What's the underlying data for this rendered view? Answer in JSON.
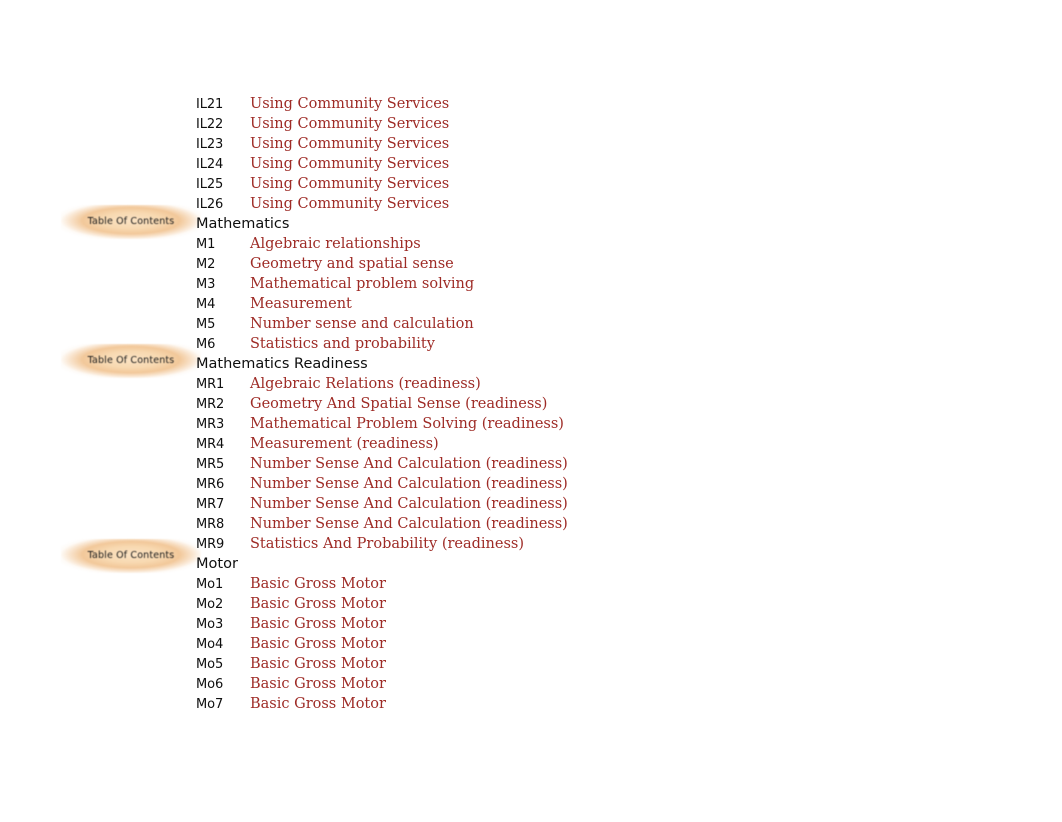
{
  "document": {
    "title": "Table Of Contents",
    "background_color": "#ffffff",
    "code_color": "#0f0f0f",
    "title_color": "#9e2b26",
    "badge_color": "#f2c89a"
  },
  "badges": [
    {
      "label": "Table Of Contents"
    },
    {
      "label": "Table Of Contents"
    },
    {
      "label": "Table Of Contents"
    }
  ],
  "outline": {
    "rows": [
      {
        "kind": "entry",
        "code": "IL21",
        "title": "Using Community Services"
      },
      {
        "kind": "entry",
        "code": "IL22",
        "title": "Using Community Services"
      },
      {
        "kind": "entry",
        "code": "IL23",
        "title": "Using Community Services"
      },
      {
        "kind": "entry",
        "code": "IL24",
        "title": "Using Community Services"
      },
      {
        "kind": "entry",
        "code": "IL25",
        "title": "Using Community Services"
      },
      {
        "kind": "entry",
        "code": "IL26",
        "title": "Using Community Services"
      },
      {
        "kind": "section",
        "code": "Mathematics",
        "title": ""
      },
      {
        "kind": "entry",
        "code": "M1",
        "title": "Algebraic relationships"
      },
      {
        "kind": "entry",
        "code": "M2",
        "title": "Geometry and spatial sense"
      },
      {
        "kind": "entry",
        "code": "M3",
        "title": "Mathematical problem solving"
      },
      {
        "kind": "entry",
        "code": "M4",
        "title": "Measurement"
      },
      {
        "kind": "entry",
        "code": "M5",
        "title": "Number sense and calculation"
      },
      {
        "kind": "entry",
        "code": "M6",
        "title": "Statistics and probability"
      },
      {
        "kind": "section",
        "code": "Mathematics Readiness",
        "title": ""
      },
      {
        "kind": "entry",
        "code": "MR1",
        "title": "Algebraic Relations (readiness)"
      },
      {
        "kind": "entry",
        "code": "MR2",
        "title": "Geometry And Spatial Sense (readiness)"
      },
      {
        "kind": "entry",
        "code": "MR3",
        "title": "Mathematical Problem Solving (readiness)"
      },
      {
        "kind": "entry",
        "code": "MR4",
        "title": "Measurement (readiness)"
      },
      {
        "kind": "entry",
        "code": "MR5",
        "title": "Number Sense And Calculation (readiness)"
      },
      {
        "kind": "entry",
        "code": "MR6",
        "title": "Number Sense And Calculation (readiness)"
      },
      {
        "kind": "entry",
        "code": "MR7",
        "title": "Number Sense And Calculation (readiness)"
      },
      {
        "kind": "entry",
        "code": "MR8",
        "title": "Number Sense And Calculation (readiness)"
      },
      {
        "kind": "entry",
        "code": "MR9",
        "title": "Statistics And Probability (readiness)"
      },
      {
        "kind": "section",
        "code": "Motor",
        "title": ""
      },
      {
        "kind": "entry",
        "code": "Mo1",
        "title": "Basic Gross Motor"
      },
      {
        "kind": "entry",
        "code": "Mo2",
        "title": "Basic Gross Motor"
      },
      {
        "kind": "entry",
        "code": "Mo3",
        "title": "Basic Gross Motor"
      },
      {
        "kind": "entry",
        "code": "Mo4",
        "title": "Basic Gross Motor"
      },
      {
        "kind": "entry",
        "code": "Mo5",
        "title": "Basic Gross Motor"
      },
      {
        "kind": "entry",
        "code": "Mo6",
        "title": "Basic Gross Motor"
      },
      {
        "kind": "entry",
        "code": "Mo7",
        "title": "Basic Gross Motor"
      }
    ]
  }
}
